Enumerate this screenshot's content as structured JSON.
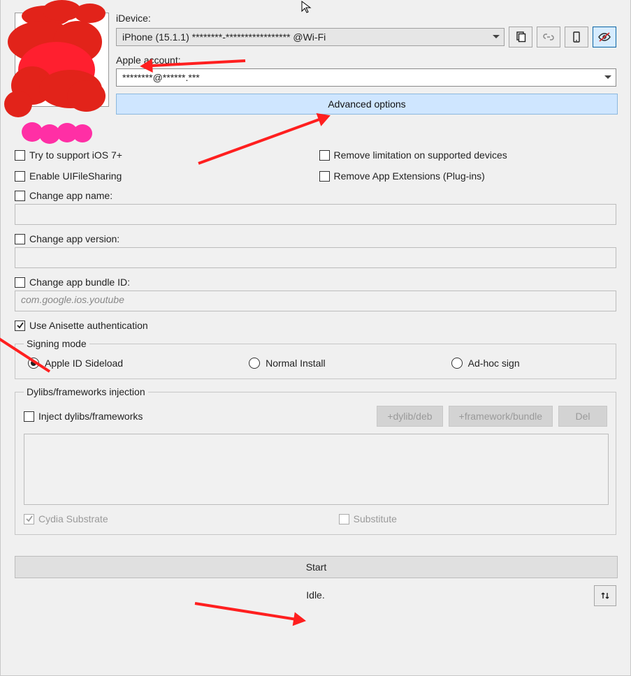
{
  "header": {
    "idevice_label": "iDevice:",
    "idevice_value": "iPhone (15.1.1) ********-***************** @Wi-Fi",
    "apple_label": "Apple account:",
    "apple_value": "********@******.***",
    "advanced_label": "Advanced options",
    "toolbar_icons": [
      "copy-icon",
      "link-icon",
      "phone-icon",
      "eye-off-icon"
    ]
  },
  "options": {
    "ios7": "Try to support iOS 7+",
    "remove_limitation": "Remove limitation on supported devices",
    "uifs": "Enable UIFileSharing",
    "remove_ext": "Remove App Extensions (Plug-ins)",
    "change_name": "Change app name:",
    "change_name_value": "",
    "change_version": "Change app version:",
    "change_version_value": "",
    "change_bundle": "Change app bundle ID:",
    "change_bundle_value": "com.google.ios.youtube",
    "anisette": "Use Anisette authentication",
    "anisette_checked": true
  },
  "signing": {
    "legend": "Signing mode",
    "r1": "Apple ID Sideload",
    "r2": "Normal Install",
    "r3": "Ad-hoc sign",
    "selected": 0
  },
  "dylib": {
    "legend": "Dylibs/frameworks injection",
    "inject": "Inject dylibs/frameworks",
    "b1": "+dylib/deb",
    "b2": "+framework/bundle",
    "b3": "Del",
    "cydia": "Cydia Substrate",
    "subst": "Substitute"
  },
  "footer": {
    "start": "Start",
    "status": "Idle."
  }
}
